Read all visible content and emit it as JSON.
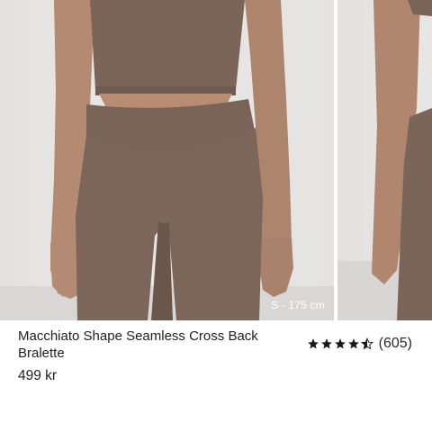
{
  "product": {
    "title": "Macchiato Shape Seamless Cross Back Bralette",
    "price": "499 kr",
    "rating": 4.5,
    "review_count": "(605)",
    "model_caption": "S - 175 cm"
  },
  "colors": {
    "fabric": "#7a6558",
    "skin": "#b08770",
    "background": "#e6e4e2",
    "star": "#1a1a1a"
  }
}
